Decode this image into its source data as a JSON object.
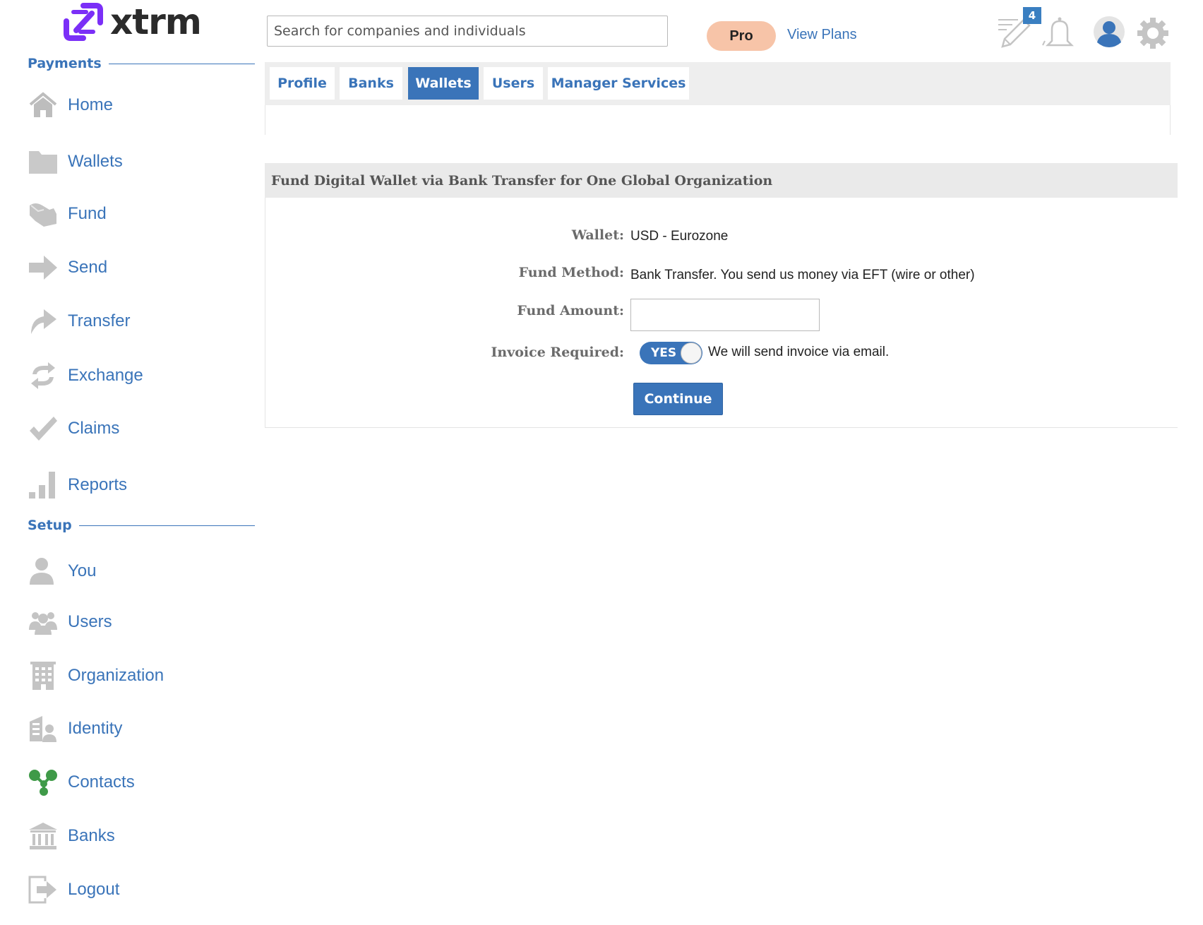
{
  "brand": {
    "name": "xtrm",
    "accent": "#7b2ff7",
    "primary": "#3a74b9"
  },
  "header": {
    "search_placeholder": "Search for companies and individuals",
    "plan_badge": "Pro",
    "view_plans": "View Plans",
    "notes_count": "4",
    "icons": [
      "edit-pencil-icon",
      "bell-icon",
      "user-avatar-icon",
      "settings-gear-icon"
    ]
  },
  "sidebar": {
    "payments_heading": "Payments",
    "setup_heading": "Setup",
    "payments": [
      {
        "label": "Home",
        "icon": "home-icon"
      },
      {
        "label": "Wallets",
        "icon": "folder-icon"
      },
      {
        "label": "Fund",
        "icon": "fund-icon"
      },
      {
        "label": "Send",
        "icon": "arrow-right-icon"
      },
      {
        "label": "Transfer",
        "icon": "transfer-arrow-icon"
      },
      {
        "label": "Exchange",
        "icon": "exchange-icon"
      },
      {
        "label": "Claims",
        "icon": "checkmark-icon"
      },
      {
        "label": "Reports",
        "icon": "bar-chart-icon"
      }
    ],
    "setup": [
      {
        "label": "You",
        "icon": "person-icon"
      },
      {
        "label": "Users",
        "icon": "users-group-icon"
      },
      {
        "label": "Organization",
        "icon": "building-icon"
      },
      {
        "label": "Identity",
        "icon": "identity-icon"
      },
      {
        "label": "Contacts",
        "icon": "contacts-network-icon"
      },
      {
        "label": "Banks",
        "icon": "bank-icon"
      },
      {
        "label": "Logout",
        "icon": "logout-icon"
      }
    ]
  },
  "tabs": [
    {
      "label": "Profile",
      "active": false
    },
    {
      "label": "Banks",
      "active": false
    },
    {
      "label": "Wallets",
      "active": true
    },
    {
      "label": "Users",
      "active": false
    },
    {
      "label": "Manager Services",
      "active": false
    }
  ],
  "form": {
    "title": "Fund Digital Wallet via Bank Transfer for One Global Organization",
    "wallet_label": "Wallet:",
    "wallet_value": "USD - Eurozone",
    "method_label": "Fund Method:",
    "method_value": "Bank Transfer. You send us money via EFT (wire or other)",
    "amount_label": "Fund Amount:",
    "amount_value": "",
    "invoice_label": "Invoice Required:",
    "invoice_toggle": "YES",
    "invoice_note": "We will send invoice via email.",
    "continue_label": "Continue"
  }
}
